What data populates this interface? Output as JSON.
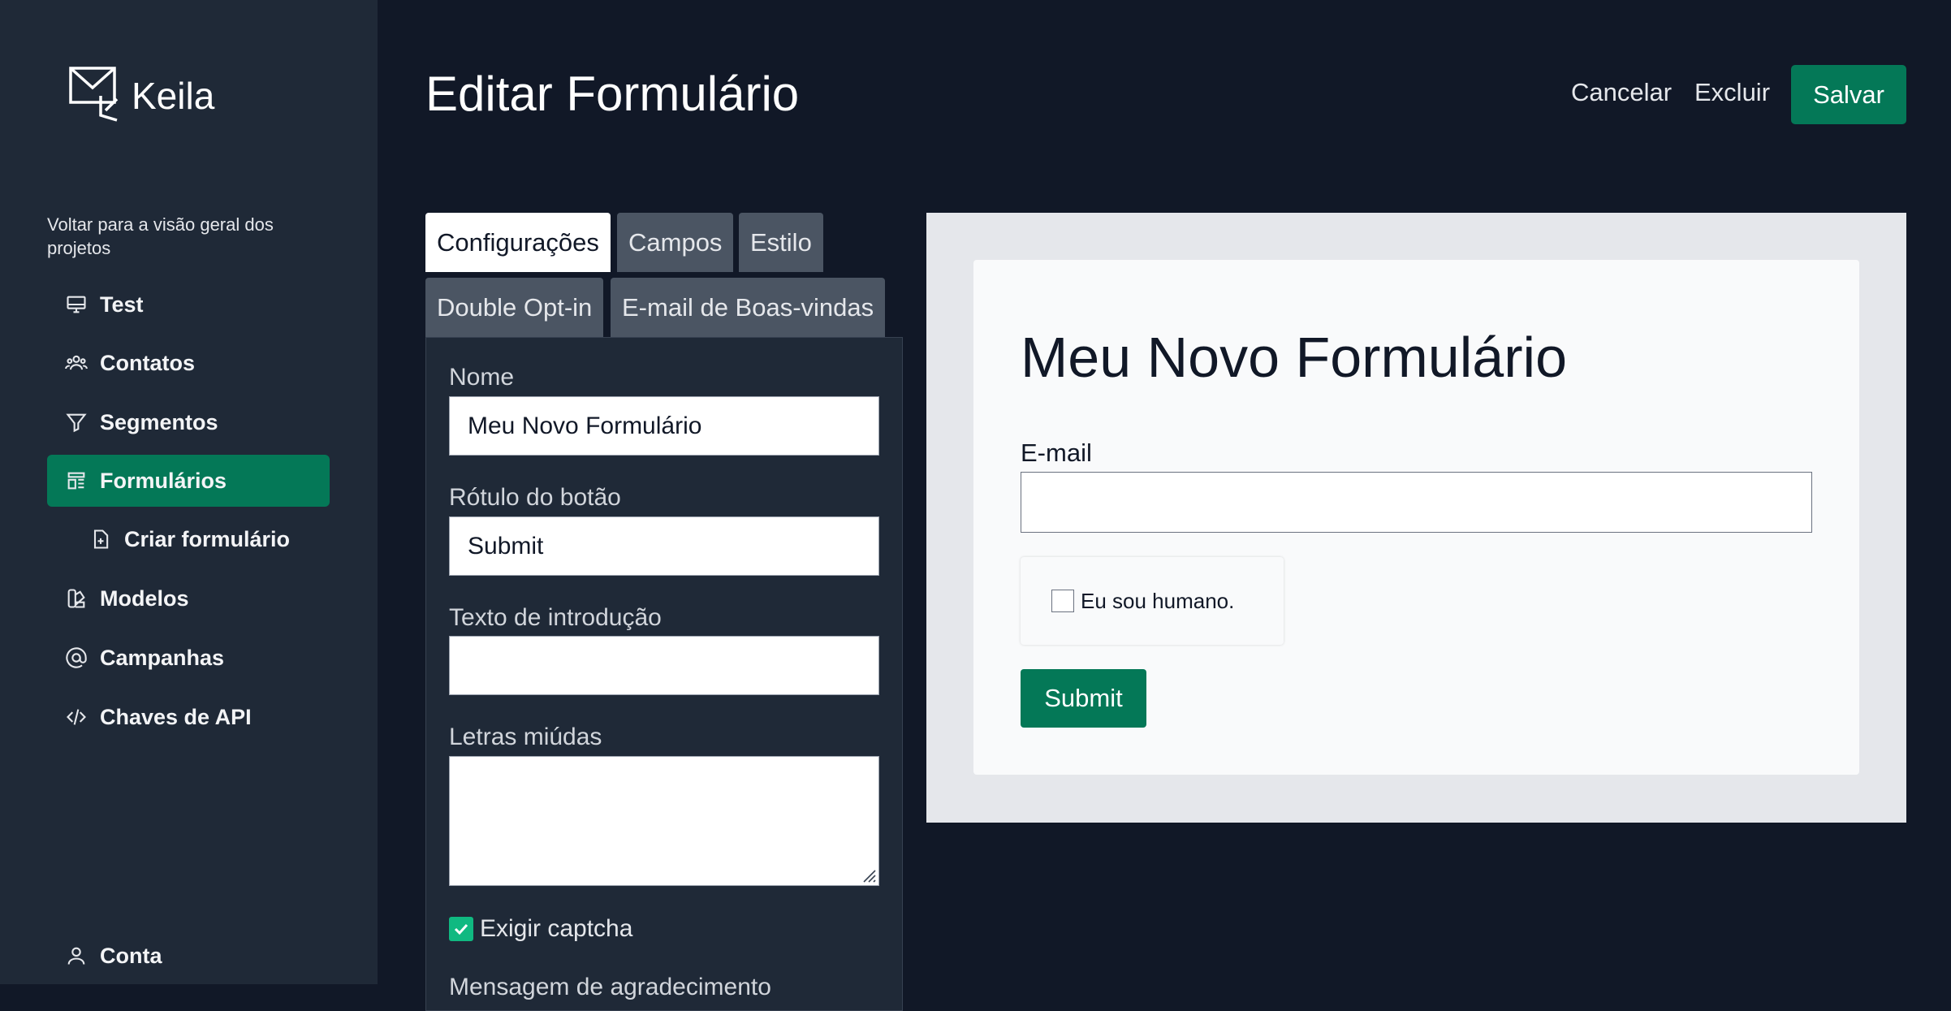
{
  "app": {
    "name": "Keila"
  },
  "sidebar": {
    "back_link": "Voltar para a visão geral dos projetos",
    "items": [
      {
        "label": "Test",
        "icon": "monitor-icon"
      },
      {
        "label": "Contatos",
        "icon": "users-icon"
      },
      {
        "label": "Segmentos",
        "icon": "filter-icon"
      },
      {
        "label": "Formulários",
        "icon": "template-icon",
        "active": true
      },
      {
        "label": "Criar formulário",
        "icon": "document-add-icon"
      },
      {
        "label": "Modelos",
        "icon": "color-swatch-icon"
      },
      {
        "label": "Campanhas",
        "icon": "at-symbol-icon"
      },
      {
        "label": "Chaves de API",
        "icon": "code-icon"
      },
      {
        "label": "Conta",
        "icon": "user-icon"
      }
    ]
  },
  "header": {
    "title": "Editar Formulário",
    "cancel": "Cancelar",
    "delete": "Excluir",
    "save": "Salvar"
  },
  "tabs": [
    "Configurações",
    "Campos",
    "Estilo",
    "Double Opt-in",
    "E-mail de Boas-vindas"
  ],
  "settings": {
    "name_label": "Nome",
    "name_value": "Meu Novo Formulário",
    "button_label_label": "Rótulo do botão",
    "button_label_value": "Submit",
    "intro_label": "Texto de introdução",
    "intro_value": "",
    "fine_print_label": "Letras miúdas",
    "fine_print_value": "",
    "captcha_label": "Exigir captcha",
    "captcha_checked": true,
    "thanks_label": "Mensagem de agradecimento"
  },
  "preview": {
    "title": "Meu Novo Formulário",
    "email_label": "E-mail",
    "captcha_text": "Eu sou humano.",
    "submit_label": "Submit"
  },
  "colors": {
    "accent": "#047857",
    "sidebar_bg": "#1f2937",
    "page_bg": "#111827"
  }
}
